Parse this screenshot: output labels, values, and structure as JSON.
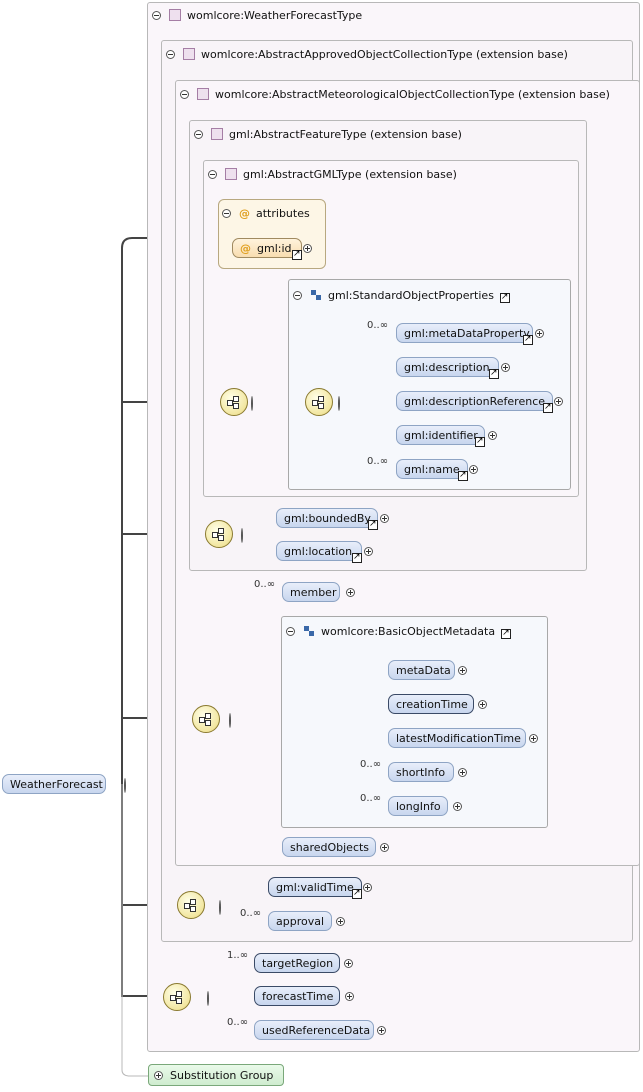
{
  "root_element": "WeatherForecast",
  "type_weather_forecast": "womlcore:WeatherForecastType",
  "type_approved_collection": "womlcore:AbstractApprovedObjectCollectionType (extension base)",
  "type_meteorological_collection": "womlcore:AbstractMeteorologicalObjectCollectionType (extension base)",
  "type_feature": "gml:AbstractFeatureType (extension base)",
  "type_gml": "gml:AbstractGMLType (extension base)",
  "attributes_label": "attributes",
  "attr_id": "gml:id",
  "group_standard_properties": "gml:StandardObjectProperties",
  "group_basic_metadata": "womlcore:BasicObjectMetadata",
  "elements": {
    "metadata_property": "gml:metaDataProperty",
    "description": "gml:description",
    "description_reference": "gml:descriptionReference",
    "identifier": "gml:identifier",
    "name": "gml:name",
    "bounded_by": "gml:boundedBy",
    "location": "gml:location",
    "member": "member",
    "meta_data": "metaData",
    "creation_time": "creationTime",
    "latest_modification_time": "latestModificationTime",
    "short_info": "shortInfo",
    "long_info": "longInfo",
    "shared_objects": "sharedObjects",
    "valid_time": "gml:validTime",
    "approval": "approval",
    "target_region": "targetRegion",
    "forecast_time": "forecastTime",
    "used_reference_data": "usedReferenceData"
  },
  "multiplicities": {
    "zero_many": "0..∞",
    "one_many": "1..∞"
  },
  "substitution_group": "Substitution Group"
}
